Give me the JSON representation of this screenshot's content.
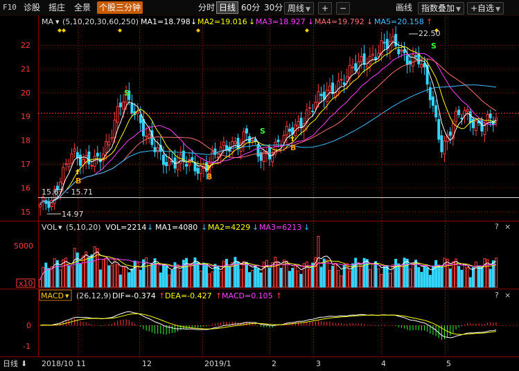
{
  "toolbar": {
    "f10": "F10",
    "diagnose": "诊股",
    "select": "摇庄",
    "panorama": "全景",
    "active_tab": "个股三分钟",
    "periods": [
      "分时",
      "日线",
      "60分",
      "30分"
    ],
    "period_selected": "日线",
    "weekly": "周线",
    "plus": "+",
    "minus": "−",
    "draw": "画线",
    "overlay": "指数叠加",
    "add_watch": "+自选"
  },
  "main_panel": {
    "indicator": "MA",
    "params": "(5,10,20,30,60,250)",
    "ma_values": [
      {
        "label": "MA1=18.798",
        "color": "#ffffff",
        "arrow": "↓"
      },
      {
        "label": "MA2=19.016",
        "color": "#ffff00",
        "arrow": "↓"
      },
      {
        "label": "MA3=18.927",
        "color": "#ff40ff",
        "arrow": "↓"
      },
      {
        "label": "MA4=19.792",
        "color": "#ff7070",
        "arrow": "↓"
      },
      {
        "label": "MA5=20.158",
        "color": "#40c0ff",
        "arrow": "↑"
      }
    ],
    "price_labels": [
      "22",
      "21",
      "20",
      "19",
      "18",
      "17",
      "16",
      "15"
    ],
    "annotations": {
      "high": "22.50",
      "low": "14.97",
      "range": "15.67 - 15.71"
    },
    "markers": {
      "s": "S",
      "b": "B"
    }
  },
  "volume_panel": {
    "indicator": "VOL",
    "params": "(5,10,20)",
    "values": [
      {
        "label": "VOL=2214",
        "color": "#ffffff",
        "arrow": "↓"
      },
      {
        "label": "MA1=4080",
        "color": "#ffffff",
        "arrow": "↓"
      },
      {
        "label": "MA2=4229",
        "color": "#ffff00",
        "arrow": "↓"
      },
      {
        "label": "MA3=6213",
        "color": "#ff40ff",
        "arrow": "↓"
      }
    ],
    "axis_label": "5000",
    "unit": "x10"
  },
  "macd_panel": {
    "indicator": "MACD",
    "params": "(26,12,9)",
    "values": [
      {
        "label": "DIF=-0.374",
        "color": "#ffffff",
        "arrow": "↑"
      },
      {
        "label": "DEA=-0.427",
        "color": "#ffff00",
        "arrow": "↑"
      },
      {
        "label": "MACD=0.105",
        "color": "#ff40ff",
        "arrow": "↑"
      }
    ],
    "axis_labels": [
      "0",
      "-1"
    ]
  },
  "panel_controls": {
    "help": "?",
    "close": "×"
  },
  "bottom_bar": {
    "period": "日线",
    "dates": [
      "2018/10",
      "11",
      "12",
      "2019/1",
      "2",
      "3",
      "4",
      "5"
    ]
  },
  "colors": {
    "up": "#ff3b3b",
    "down": "#33d6ff",
    "grid": "#8b0000",
    "ma1": "#ffffff",
    "ma2": "#ffff00",
    "ma3": "#ff40ff",
    "ma4": "#ff7070",
    "ma5": "#40c0ff"
  }
}
